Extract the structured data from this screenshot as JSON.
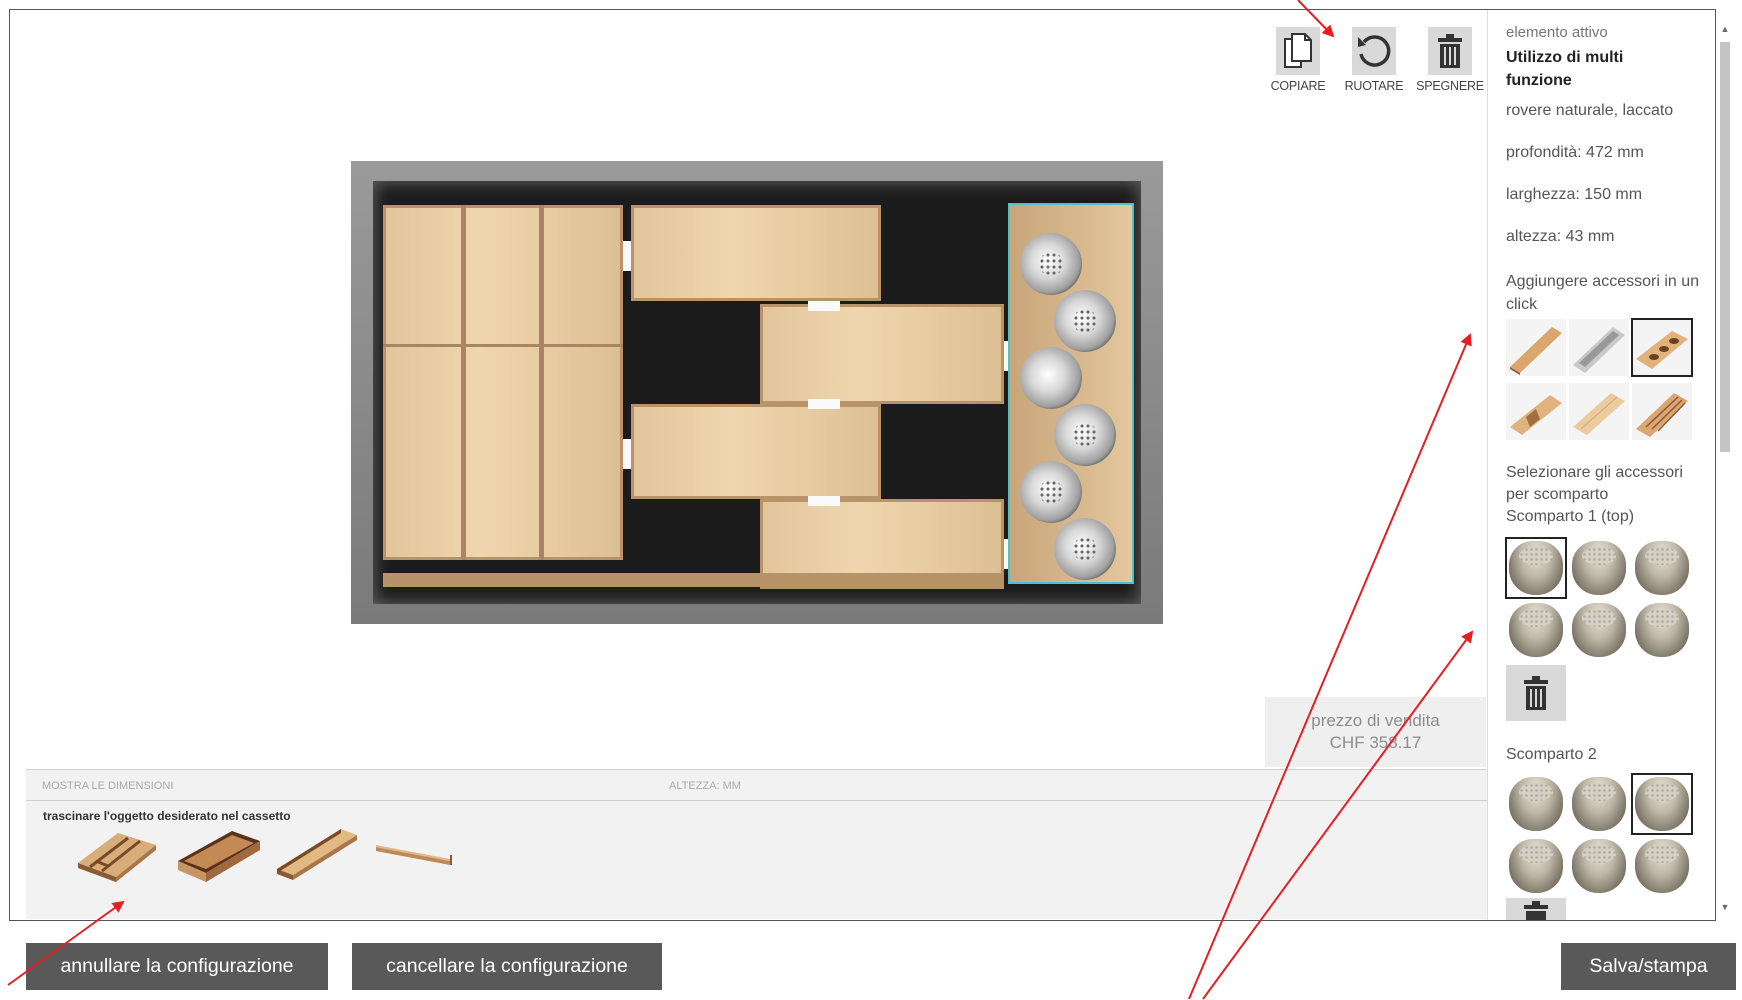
{
  "toolbar": {
    "copy_label": "COPIARE",
    "rotate_label": "RUOTARE",
    "delete_label": "SPEGNERE"
  },
  "price": {
    "label": "prezzo di vendita",
    "value": "CHF 358.17"
  },
  "palette": {
    "show_dimensions": "MOSTRA LE DIMENSIONI",
    "height_label": "ALTEZZA: MM",
    "hint": "trascinare l'oggetto desiderato nel cassetto",
    "items": [
      "cutlery-insert",
      "wooden-box",
      "wooden-tray",
      "wooden-divider-strip"
    ]
  },
  "panel": {
    "active_label": "elemento attivo",
    "active_name": "Utilizzo di multi funzione",
    "material": "rovere naturale, laccato",
    "depth": "profondità: 472 mm",
    "width": "larghezza: 150 mm",
    "height": "altezza: 43 mm",
    "accessories_title": "Aggiungere accessori in un click",
    "select_title_1": "Selezionare gli accessori",
    "select_title_2": "per scomparto",
    "compartment1": "Scomparto 1 (top)",
    "compartment2": "Scomparto 2",
    "accessories": [
      "tray-accessory",
      "aluminium-tray-accessory",
      "spice-board-accessory",
      "divider-accessory",
      "flat-board-accessory",
      "knife-block-accessory"
    ],
    "compartment1_selected": 0,
    "compartment2_selected": 2
  },
  "buttons": {
    "undo": "annullare la configurazione",
    "clear": "cancellare la configurazione",
    "save": "Salva/stampa"
  },
  "colors": {
    "button_bg": "#595959",
    "tray_outline": "#4fc2c8",
    "annotation": "#e31e24"
  }
}
